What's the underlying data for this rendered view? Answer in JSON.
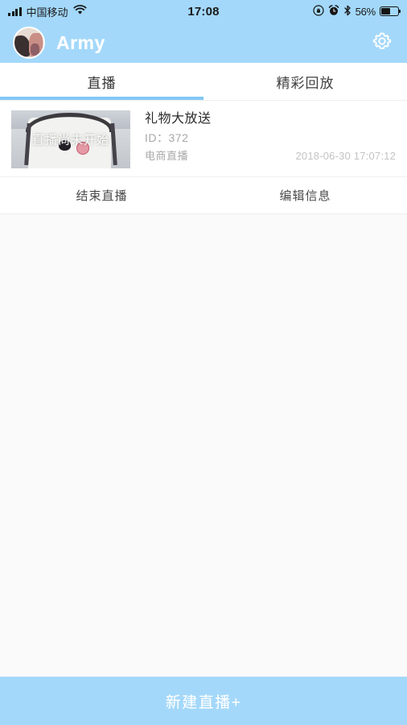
{
  "status_bar": {
    "carrier": "中国移动",
    "time": "17:08",
    "battery_percent": "56%",
    "battery_level": 56,
    "icons": {
      "signal": "signal-bars-icon",
      "wifi": "wifi-icon",
      "rotation_lock": "rotation-lock-icon",
      "alarm": "alarm-clock-icon",
      "bluetooth": "bluetooth-icon",
      "battery": "battery-icon"
    }
  },
  "header": {
    "username": "Army",
    "avatar": "user-avatar",
    "settings_icon": "gear-icon",
    "background_color": "#a3d8fa"
  },
  "tabs": [
    {
      "label": "直播",
      "active": true
    },
    {
      "label": "精彩回放",
      "active": false
    }
  ],
  "tab_indicator_color": "#82c8f5",
  "live_card": {
    "thumbnail_overlay_text": "直播尚未开始",
    "title": "礼物大放送",
    "id_label": "ID：",
    "id_value": "372",
    "category": "电商直播",
    "timestamp": "2018-06-30 17:07:12"
  },
  "card_actions": [
    {
      "label": "结束直播"
    },
    {
      "label": "编辑信息"
    }
  ],
  "bottom_button": {
    "label": "新建直播+",
    "background_color": "#a3d8fa"
  }
}
